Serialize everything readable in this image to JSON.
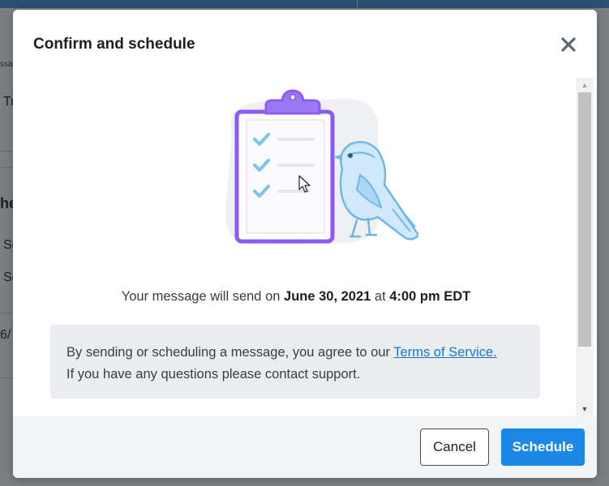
{
  "background": {
    "fragments": [
      "ssa",
      "Tr",
      "he",
      "Se",
      "Se",
      "6/"
    ]
  },
  "modal": {
    "title": "Confirm and schedule",
    "send_prefix": "Your message will send on ",
    "send_date": "June 30, 2021",
    "send_at": " at ",
    "send_time": "4:00 pm EDT",
    "notice_line1_prefix": "By sending or scheduling a message, you agree to our ",
    "notice_link": "Terms of Service.",
    "notice_line2": "If you have any questions please contact support.",
    "buttons": {
      "cancel": "Cancel",
      "schedule": "Schedule"
    }
  },
  "icons": {
    "close": "close-icon",
    "illustration": "clipboard-bird-illustration",
    "cursor": "mouse-pointer-icon"
  },
  "colors": {
    "primary": "#1b87e6",
    "link": "#1877c9",
    "clipboard": "#8a5cf5",
    "check": "#7cc3ef",
    "bird": "#a9d8f5"
  }
}
